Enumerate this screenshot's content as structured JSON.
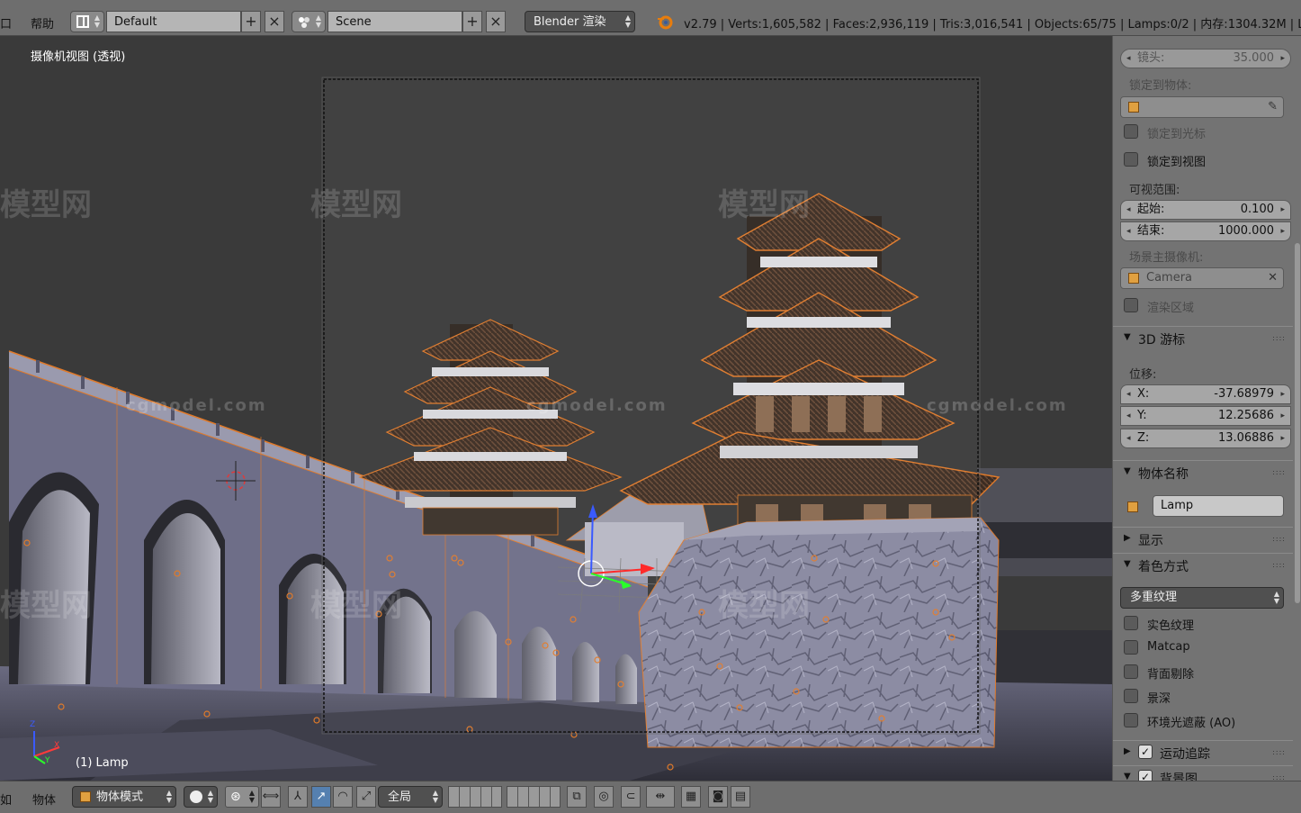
{
  "topbar": {
    "menu_left": "口",
    "menu_help": "帮助",
    "layout_name": "Default",
    "scene_name": "Scene",
    "render_engine": "Blender 渲染",
    "stats": "v2.79 | Verts:1,605,582 | Faces:2,936,119 | Tris:3,016,541 | Objects:65/75 | Lamps:0/2 | 内存:1304.32M | La",
    "icons": [
      "screen-layout-icon",
      "add-icon",
      "close-icon",
      "scene-icon",
      "blender-logo-icon"
    ]
  },
  "viewport": {
    "view_label": "摄像机视图 (透视)",
    "object_label": "(1) Lamp",
    "watermarks": [
      "模型网",
      "模型网",
      "模型网",
      "模型网",
      "模型网",
      "模型网",
      "模型网"
    ],
    "watermark_urls": [
      "cgmodel.com",
      "cgmodel.com",
      "cgmodel.com"
    ],
    "axis_labels": {
      "x": "X",
      "y": "Y",
      "z": "Z"
    }
  },
  "panel": {
    "lens": {
      "label": "镜头:",
      "value": "35.000"
    },
    "lock_to_object_label": "锁定到物体:",
    "lock_to_cursor": "锁定到光标",
    "lock_to_view": "锁定到视图",
    "clip_label": "可视范围:",
    "clip_start": {
      "label": "起始:",
      "value": "0.100"
    },
    "clip_end": {
      "label": "结束:",
      "value": "1000.000"
    },
    "scene_camera_label": "场景主摄像机:",
    "scene_camera": "Camera",
    "render_border": "渲染区域",
    "cursor_section": "3D 游标",
    "location_label": "位移:",
    "cursor_x": {
      "label": "X:",
      "value": "-37.68979"
    },
    "cursor_y": {
      "label": "Y:",
      "value": "12.25686"
    },
    "cursor_z": {
      "label": "Z:",
      "value": "13.06886"
    },
    "object_name_section": "物体名称",
    "object_name": "Lamp",
    "display_section": "显示",
    "shading_section": "着色方式",
    "shading_mode": "多重纹理",
    "solid_tex": "实色纹理",
    "matcap": "Matcap",
    "backface": "背面剔除",
    "dof": "景深",
    "ao": "环境光遮蔽 (AO)",
    "motion_tracking": "运动追踪",
    "background_images": "背景图"
  },
  "bottombar": {
    "menu_left": "如",
    "menu_object": "物体",
    "mode": "物体模式",
    "pivot_label": "全局",
    "icons": [
      "viewport-shading-icon",
      "pivot-icon",
      "manipulator-icon",
      "translate-icon",
      "rotate-icon",
      "scale-icon",
      "lock-camera-icon",
      "proportional-edit-icon",
      "snap-icon",
      "snap-element-icon",
      "render-icon",
      "camera-icon",
      "clapper-icon"
    ]
  },
  "colors": {
    "header": "#6e6e6e",
    "viewport_bg": "#3a3a3a",
    "selection_orange": "#e07a2a",
    "panel_bg": "#737373"
  }
}
